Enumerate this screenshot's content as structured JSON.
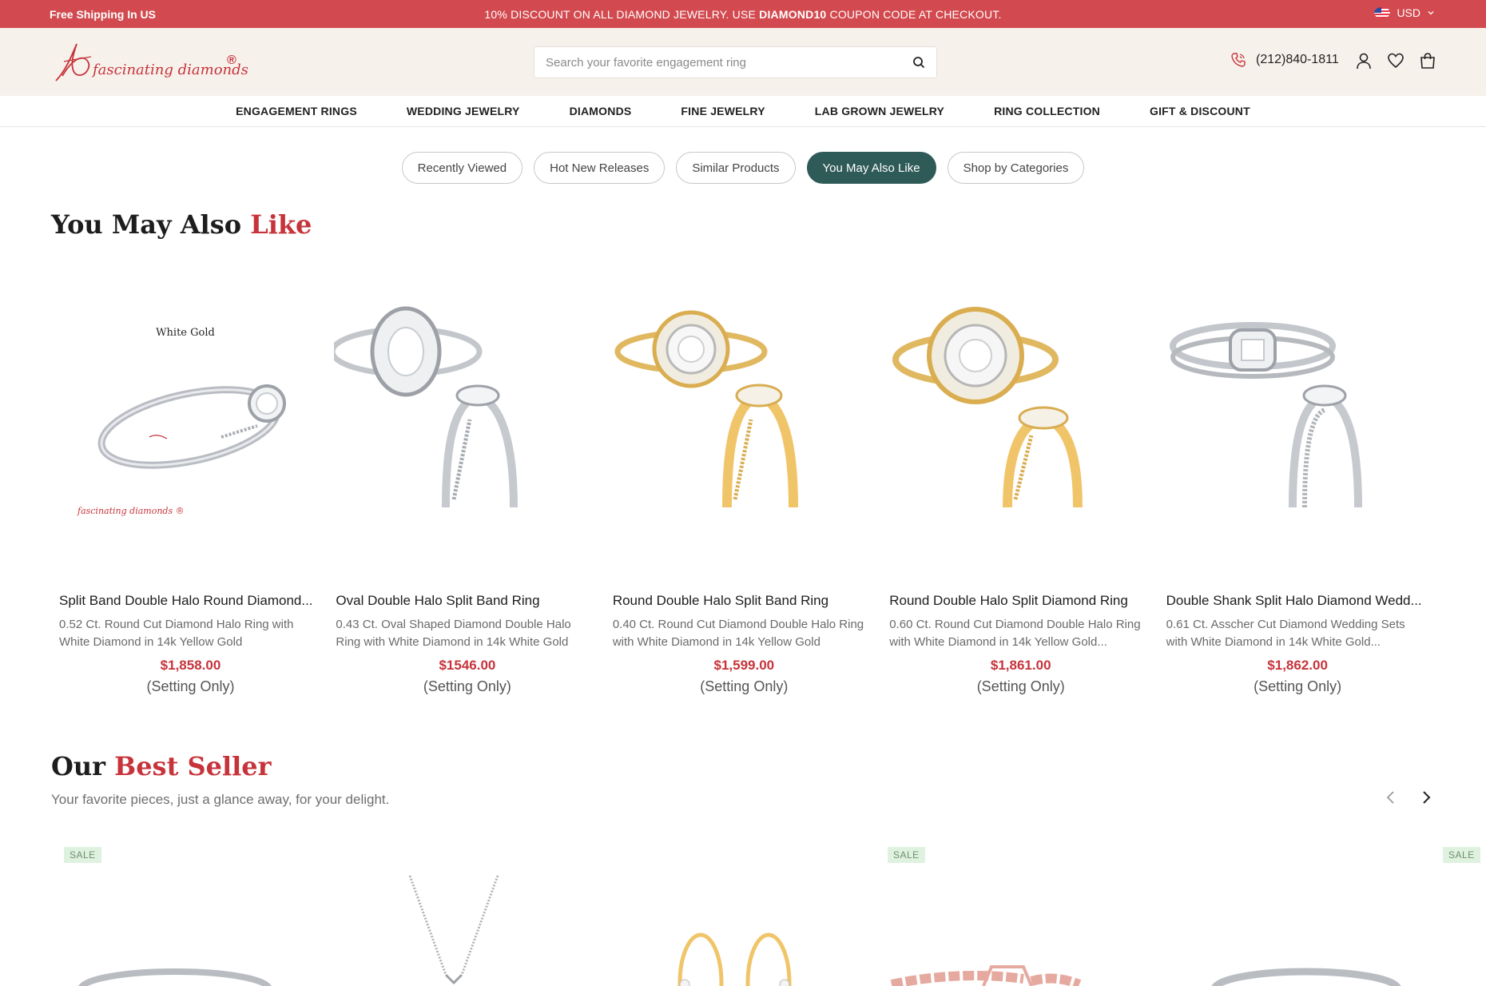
{
  "topbar": {
    "shipping": "Free Shipping In US",
    "promo_prefix": "10% DISCOUNT ON ALL DIAMOND JEWELRY. USE ",
    "promo_code": "DIAMOND10",
    "promo_suffix": " COUPON CODE AT CHECKOUT.",
    "currency": "USD"
  },
  "header": {
    "logo_text": "fascinating diamonds",
    "logo_mark": "®",
    "search_placeholder": "Search your favorite engagement ring",
    "phone": "(212)840-1811"
  },
  "nav": {
    "items": [
      "ENGAGEMENT RINGS",
      "WEDDING JEWELRY",
      "DIAMONDS",
      "FINE JEWELRY",
      "LAB GROWN JEWELRY",
      "RING COLLECTION",
      "GIFT & DISCOUNT"
    ]
  },
  "pills": {
    "items": [
      "Recently Viewed",
      "Hot New Releases",
      "Similar Products",
      "You May Also Like",
      "Shop by Categories"
    ],
    "active": "You May Also Like"
  },
  "you_may_also_like": {
    "title_main": "You May Also ",
    "title_accent": "Like",
    "products": [
      {
        "name": "Split Band Double Halo Round Diamond...",
        "desc": "0.52 Ct. Round Cut Diamond Halo Ring with White Diamond in 14k Yellow Gold",
        "price": "$1,858.00",
        "setting": "(Setting Only)",
        "image_label": "White Gold",
        "metal": "white"
      },
      {
        "name": "Oval Double Halo Split Band Ring",
        "desc": "0.43 Ct. Oval Shaped Diamond Double Halo Ring with White Diamond in 14k White Gold",
        "price": "$1546.00",
        "setting": "(Setting Only)",
        "metal": "white"
      },
      {
        "name": "Round Double Halo Split Band Ring",
        "desc": "0.40 Ct. Round Cut Diamond Double Halo Ring with White Diamond in 14k Yellow Gold",
        "price": "$1,599.00",
        "setting": "(Setting Only)",
        "metal": "yellow"
      },
      {
        "name": "Round Double Halo Split Diamond Ring",
        "desc": "0.60 Ct. Round Cut Diamond Double Halo Ring with White Diamond in 14k Yellow Gold...",
        "price": "$1,861.00",
        "setting": "(Setting Only)",
        "metal": "yellow"
      },
      {
        "name": "Double Shank Split Halo Diamond Wedd...",
        "desc": "0.61 Ct. Asscher Cut Diamond Wedding Sets with White Diamond in 14k White Gold...",
        "price": "$1,862.00",
        "setting": "(Setting Only)",
        "metal": "white"
      }
    ]
  },
  "best_seller": {
    "title_main": "Our ",
    "title_accent": "Best Seller",
    "subtitle": "Your favorite pieces, just a glance away, for your delight.",
    "sale_label": "SALE"
  },
  "colors": {
    "brand_red": "#d24a4f",
    "accent_red": "#c7333a",
    "active_pill": "#2e5a57",
    "header_bg": "#f7f1ec"
  }
}
